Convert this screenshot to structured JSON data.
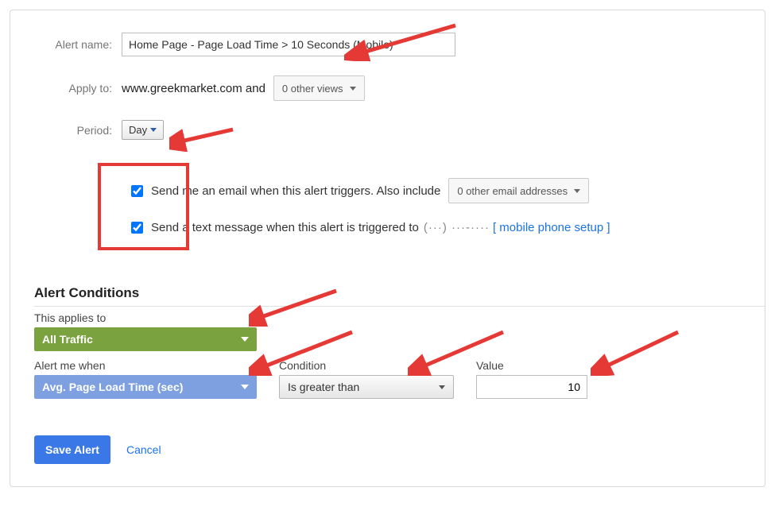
{
  "labels": {
    "alert_name": "Alert name:",
    "apply_to": "Apply to:",
    "period": "Period:"
  },
  "alert_name_value": "Home Page - Page Load Time > 10 Seconds (Mobile)",
  "apply_to_site": "www.greekmarket.com",
  "apply_to_and": " and",
  "other_views": "0 other views",
  "period_value": "Day",
  "notify": {
    "email_label": "Send me an email when this alert triggers. Also include",
    "email_dropdown": "0 other email addresses",
    "sms_label": "Send a text message when this alert is triggered to",
    "sms_phone_masked": "(···) ···-····",
    "sms_setup_link": "[ mobile phone setup ]"
  },
  "conditions": {
    "title": "Alert Conditions",
    "applies_to_label": "This applies to",
    "applies_to_value": "All Traffic",
    "alert_when_label": "Alert me when",
    "alert_when_value": "Avg. Page Load Time (sec)",
    "condition_label": "Condition",
    "condition_value": "Is greater than",
    "value_label": "Value",
    "value_value": "10"
  },
  "actions": {
    "save": "Save Alert",
    "cancel": "Cancel"
  }
}
